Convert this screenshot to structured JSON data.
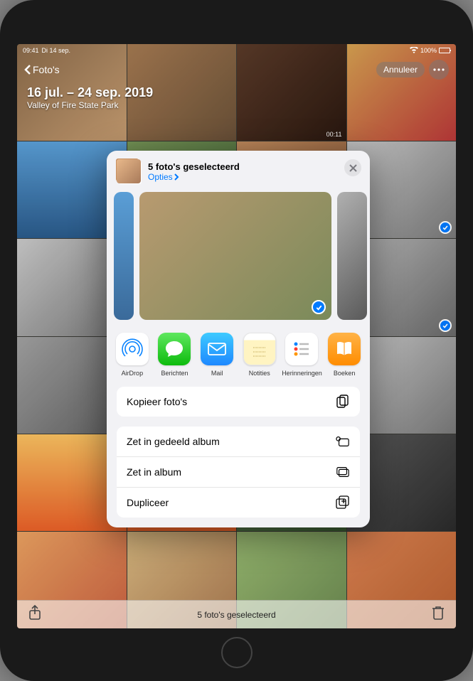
{
  "statusBar": {
    "time": "09:41",
    "date": "Di 14 sep.",
    "battery": "100%"
  },
  "nav": {
    "back": "Foto's",
    "cancel": "Annuleer",
    "dateRange": "16 jul. – 24 sep. 2019",
    "location": "Valley of Fire State Park",
    "clipDuration": "00:11"
  },
  "shareSheet": {
    "title": "5 foto's geselecteerd",
    "options": "Opties",
    "apps": [
      {
        "label": "AirDrop",
        "key": "airdrop"
      },
      {
        "label": "Berichten",
        "key": "messages"
      },
      {
        "label": "Mail",
        "key": "mail"
      },
      {
        "label": "Notities",
        "key": "notes"
      },
      {
        "label": "Herinneringen",
        "key": "reminders"
      },
      {
        "label": "Boeken",
        "key": "books"
      }
    ],
    "actions": {
      "copy": "Kopieer foto's",
      "sharedAlbum": "Zet in gedeeld album",
      "album": "Zet in album",
      "duplicate": "Dupliceer"
    }
  },
  "bottom": {
    "selectionCount": "5 foto's geselecteerd"
  }
}
